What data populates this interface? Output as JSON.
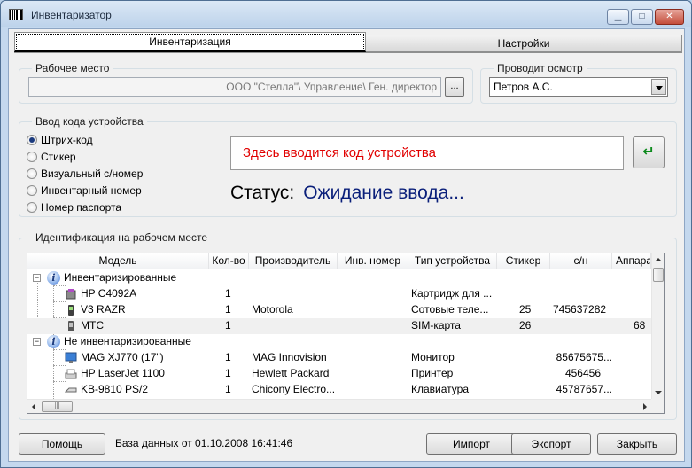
{
  "window": {
    "title": "Инвентаризатор",
    "min_label": "▁",
    "max_label": "□",
    "close_label": "✕"
  },
  "tabs": [
    {
      "label": "Инвентаризация",
      "active": true
    },
    {
      "label": "Настройки",
      "active": false
    }
  ],
  "workplace": {
    "legend": "Рабочее место",
    "value": "ООО \"Стелла\"\\ Управление\\ Ген. директор",
    "browse_label": "..."
  },
  "inspector": {
    "legend": "Проводит осмотр",
    "selected": "Петров А.С."
  },
  "code_entry": {
    "legend": "Ввод кода устройства",
    "options": [
      {
        "label": "Штрих-код",
        "checked": true
      },
      {
        "label": "Стикер",
        "checked": false
      },
      {
        "label": "Визуальный с/номер",
        "checked": false
      },
      {
        "label": "Инвентарный номер",
        "checked": false
      },
      {
        "label": "Номер паспорта",
        "checked": false
      }
    ],
    "placeholder": "Здесь вводится код устройства",
    "enter_icon": "↵",
    "status_label": "Статус:",
    "status_value": "Ожидание ввода..."
  },
  "identification": {
    "legend": "Идентификация на рабочем месте",
    "columns": [
      "Модель",
      "Кол-во",
      "Производитель",
      "Инв. номер",
      "Тип устройства",
      "Стикер",
      "с/н",
      "Аппара"
    ],
    "groups": [
      {
        "label": "Инвентаризированные",
        "icon": "info-icon",
        "rows": [
          {
            "icon": "cartridge-icon",
            "model": "HP C4092A",
            "qty": "1",
            "vendor": "",
            "inv": "",
            "type": "Картридж для ...",
            "sticker": "",
            "sn": "",
            "app": ""
          },
          {
            "icon": "cell-phone-icon",
            "model": "V3 RAZR",
            "qty": "1",
            "vendor": "Motorola",
            "inv": "",
            "type": "Сотовые теле...",
            "sticker": "25",
            "sn": "745637282",
            "app": ""
          },
          {
            "icon": "sim-card-icon",
            "model": "МТС",
            "qty": "1",
            "vendor": "",
            "inv": "",
            "type": "SIM-карта",
            "sticker": "26",
            "sn": "",
            "app": "68"
          }
        ]
      },
      {
        "label": "Не инвентаризированные",
        "icon": "info-icon",
        "rows": [
          {
            "icon": "monitor-icon",
            "model": "MAG XJ770 (17\")",
            "qty": "1",
            "vendor": "MAG Innovision",
            "inv": "",
            "type": "Монитор",
            "sticker": "",
            "sn": "85675675...",
            "app": ""
          },
          {
            "icon": "printer-icon",
            "model": "HP LaserJet 1100",
            "qty": "1",
            "vendor": "Hewlett Packard",
            "inv": "",
            "type": "Принтер",
            "sticker": "",
            "sn": "456456",
            "app": ""
          },
          {
            "icon": "keyboard-icon",
            "model": "KB-9810 PS/2",
            "qty": "1",
            "vendor": "Chicony Electro...",
            "inv": "",
            "type": "Клавиатура",
            "sticker": "",
            "sn": "45787657...",
            "app": ""
          }
        ]
      }
    ]
  },
  "footer": {
    "help_label": "Помощь",
    "db_info": "База данных от 01.10.2008 16:41:46",
    "import_label": "Импорт",
    "export_label": "Экспорт",
    "close_label": "Закрыть"
  }
}
